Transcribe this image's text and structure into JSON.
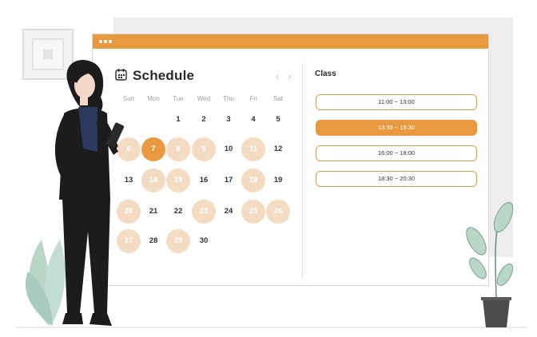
{
  "window": {
    "title": "Schedule",
    "calendar_icon": "calendar-icon",
    "prev_label": "‹",
    "next_label": "›"
  },
  "weekdays": [
    "Sun",
    "Mon",
    "Tue",
    "Wed",
    "Thu",
    "Fri",
    "Sat"
  ],
  "days": [
    {
      "d": "1",
      "status": ""
    },
    {
      "d": "2",
      "status": ""
    },
    {
      "d": "3",
      "status": ""
    },
    {
      "d": "4",
      "status": ""
    },
    {
      "d": "5",
      "status": ""
    },
    {
      "d": "6",
      "status": "booked"
    },
    {
      "d": "7",
      "status": "selected"
    },
    {
      "d": "8",
      "status": "booked"
    },
    {
      "d": "9",
      "status": "booked"
    },
    {
      "d": "10",
      "status": ""
    },
    {
      "d": "11",
      "status": "booked"
    },
    {
      "d": "12",
      "status": ""
    },
    {
      "d": "13",
      "status": ""
    },
    {
      "d": "14",
      "status": "booked"
    },
    {
      "d": "15",
      "status": "booked"
    },
    {
      "d": "16",
      "status": ""
    },
    {
      "d": "17",
      "status": ""
    },
    {
      "d": "18",
      "status": "booked"
    },
    {
      "d": "19",
      "status": ""
    },
    {
      "d": "20",
      "status": "booked"
    },
    {
      "d": "21",
      "status": ""
    },
    {
      "d": "22",
      "status": ""
    },
    {
      "d": "23",
      "status": "booked"
    },
    {
      "d": "24",
      "status": ""
    },
    {
      "d": "25",
      "status": "booked"
    },
    {
      "d": "26",
      "status": "booked"
    },
    {
      "d": "27",
      "status": "booked"
    },
    {
      "d": "28",
      "status": ""
    },
    {
      "d": "29",
      "status": "booked"
    },
    {
      "d": "30",
      "status": ""
    }
  ],
  "class_panel": {
    "title": "Class",
    "slots": [
      {
        "time": "11:00 ~ 13:00",
        "active": false
      },
      {
        "time": "13:30 ~ 15:30",
        "active": true
      },
      {
        "time": "16:00 ~ 18:00",
        "active": false
      },
      {
        "time": "18:30 ~ 20:30",
        "active": false
      }
    ]
  },
  "colors": {
    "accent": "#e99a40",
    "booked": "#f3dcc2",
    "plant": "#b9d6c9",
    "suit": "#1c1c1c"
  }
}
